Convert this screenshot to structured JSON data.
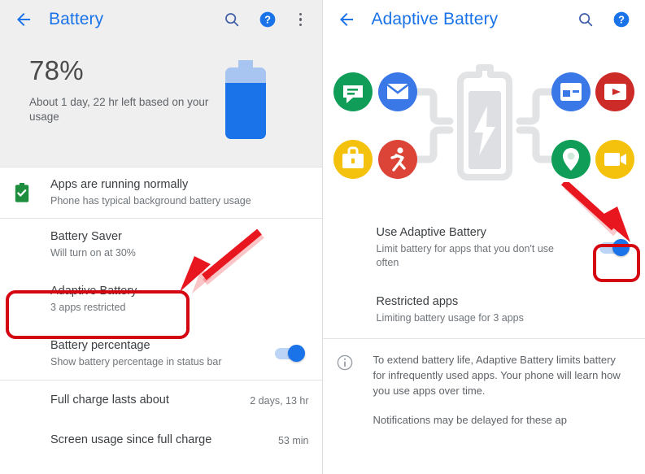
{
  "left": {
    "appbar": {
      "back_icon": "arrow-left-icon",
      "title": "Battery",
      "search_icon": "search-icon",
      "help_icon": "help-circle-icon",
      "overflow_icon": "more-vertical-icon"
    },
    "hero": {
      "percent": "78%",
      "subtitle": "About 1 day, 22 hr left based on your usage",
      "battery_icon": "battery-78-icon",
      "battery_level": 78
    },
    "rows": [
      {
        "icon": "battery-check-green-icon",
        "title": "Apps are running normally",
        "sub": "Phone has typical background battery usage"
      },
      {
        "title": "Battery Saver",
        "sub": "Will turn on at 30%"
      },
      {
        "title": "Adaptive Battery",
        "sub": "3 apps restricted",
        "highlighted": true
      },
      {
        "title": "Battery percentage",
        "sub": "Show battery percentage in status bar",
        "toggle": "on"
      }
    ],
    "kv_rows": [
      {
        "title": "Full charge lasts about",
        "value": "2 days, 13 hr"
      },
      {
        "title": "Screen usage since full charge",
        "value": "53 min"
      }
    ]
  },
  "right": {
    "appbar": {
      "back_icon": "arrow-left-icon",
      "title": "Adaptive Battery",
      "search_icon": "search-icon",
      "help_icon": "help-circle-icon"
    },
    "illustration": {
      "name": "adaptive-battery-illustration",
      "center_icon": "battery-charging-icon",
      "app_icons": [
        "messages-icon",
        "mail-icon",
        "briefcase-icon",
        "fitness-run-icon",
        "calendar-icon",
        "video-player-icon",
        "maps-pin-icon",
        "camera-icon"
      ]
    },
    "rows": [
      {
        "title": "Use Adaptive Battery",
        "sub": "Limit battery for apps that you don't use often",
        "toggle": "on",
        "highlighted": true
      },
      {
        "title": "Restricted apps",
        "sub": "Limiting battery usage for 3 apps"
      }
    ],
    "info": {
      "icon": "info-circle-icon",
      "paragraphs": [
        "To extend battery life, Adaptive Battery limits battery for infrequently used apps. Your phone will learn how you use apps over time.",
        "Notifications may be delayed for these ap"
      ]
    }
  },
  "annotations": {
    "arrow_color": "#e8161f",
    "highlight_color": "#d40511",
    "left_arrow": "red-arrow-pointing-to-adaptive-battery",
    "right_arrow": "red-arrow-pointing-to-toggle"
  },
  "colors": {
    "accent_blue": "#1a73e8",
    "header_gray": "#efefef",
    "text_primary": "#3c4043",
    "text_secondary": "#70757a",
    "green": "#0f9d58",
    "red": "#db4437",
    "yellow": "#f4c20d"
  }
}
